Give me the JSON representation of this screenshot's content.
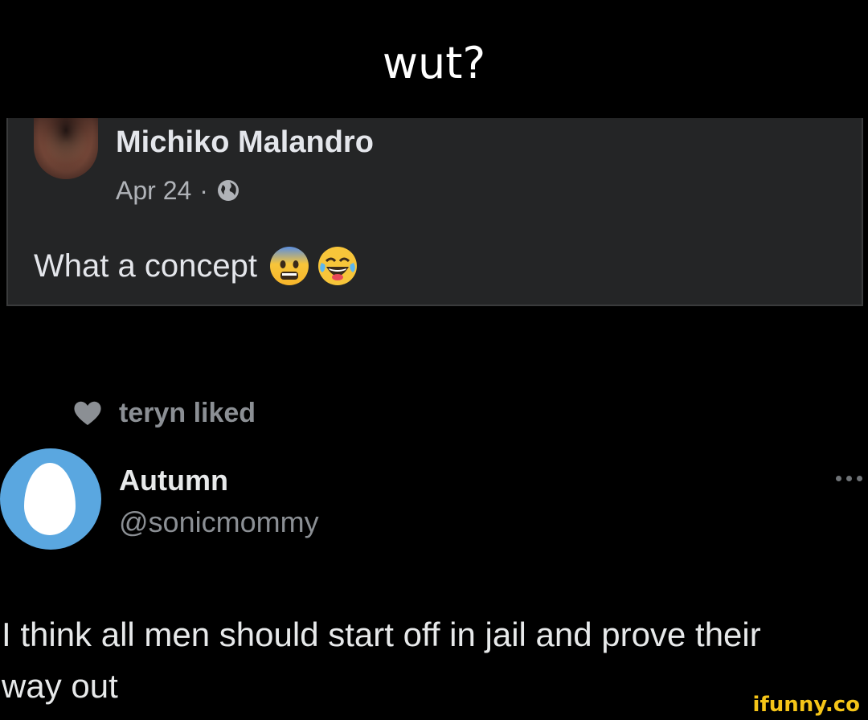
{
  "caption": "wut?",
  "facebook_post": {
    "author": "Michiko Malandro",
    "date": "Apr 24",
    "separator": "·",
    "visibility_icon": "globe-icon",
    "text": "What a concept",
    "emojis": [
      "anxious-face-emoji",
      "tears-of-joy-emoji"
    ]
  },
  "tweet": {
    "liked_by": "teryn liked",
    "author_name": "Autumn",
    "handle": "@sonicmommy",
    "text_line1": "I think all men should start off in jail and prove their",
    "text_line2": "way out"
  },
  "watermark": "ifunny.co",
  "colors": {
    "background": "#000000",
    "fb_card": "#242526",
    "tw_avatar": "#5aa7e0",
    "watermark": "#f5c518"
  }
}
